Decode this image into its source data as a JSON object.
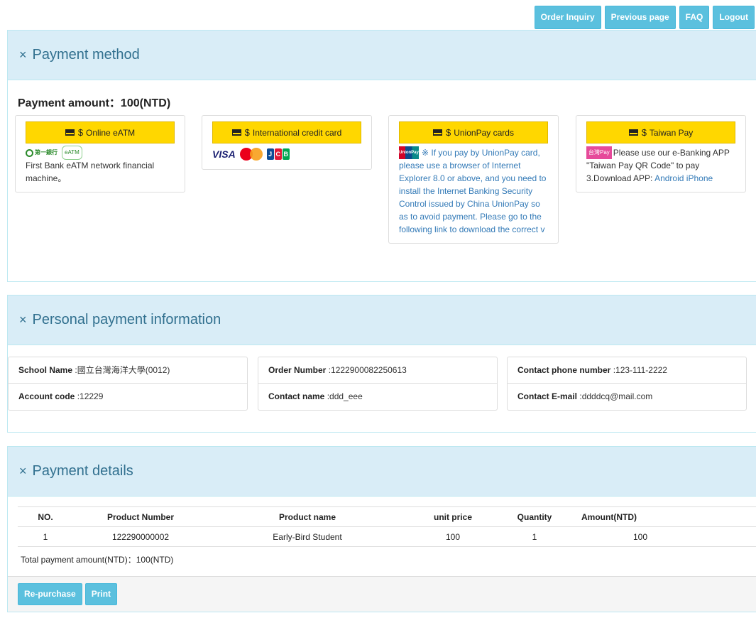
{
  "topnav": {
    "order_inquiry": "Order Inquiry",
    "previous_page": "Previous page",
    "faq": "FAQ",
    "logout": "Logout"
  },
  "payment_method": {
    "header": "Payment method",
    "close_glyph": "×",
    "amount_label": "Payment amount：",
    "amount_value": "100(NTD)",
    "options": [
      {
        "title": "Online eATM",
        "logo_1": "第一銀行",
        "logo_2": "eATM",
        "description": "First Bank eATM network financial machine。"
      },
      {
        "title": "International credit card",
        "logo_visa": "VISA",
        "logo_mc": "MasterCard",
        "logo_jcb": [
          "J",
          "C",
          "B"
        ]
      },
      {
        "title": "UnionPay cards",
        "logo": "UnionPay",
        "description": "※ If you pay by UnionPay card, please use a browser of Internet Explorer 8.0 or above, and you need to install the Internet Banking Security Control issued by China UnionPay so as to avoid payment. Please go to the following link to download the correct v"
      },
      {
        "title": "Taiwan Pay",
        "logo": "台灣Pay",
        "description": "Please use our e-Banking APP \"Taiwan Pay QR Code\" to pay 3.Download APP:",
        "link_android": "Android",
        "link_iphone": "iPhone"
      }
    ]
  },
  "personal": {
    "header": "Personal payment information",
    "fields": [
      {
        "label": "School Name",
        "value": ":國立台灣海洋大學(0012)"
      },
      {
        "label": "Account code",
        "value": ":12229"
      },
      {
        "label": "Order Number",
        "value": ":1222900082250613"
      },
      {
        "label": "Contact name",
        "value": ":ddd_eee"
      },
      {
        "label": "Contact phone number",
        "value": ":123-111-2222"
      },
      {
        "label": "Contact E-mail",
        "value": ":ddddcq@mail.com"
      }
    ]
  },
  "details": {
    "header": "Payment details",
    "columns": [
      "NO.",
      "Product Number",
      "Product name",
      "unit price",
      "Quantity",
      "Amount(NTD)"
    ],
    "rows": [
      [
        "1",
        "122290000002",
        "Early-Bird Student",
        "100",
        "1",
        "100"
      ]
    ],
    "total": "Total payment amount(NTD)：100(NTD)",
    "repurchase": "Re-purchase",
    "print": "Print"
  },
  "colors": {
    "accent": "#5bc0de",
    "panel_header": "#d9edf7",
    "panel_title": "#31708f",
    "pay_button": "#ffd700",
    "link": "#337ab7"
  }
}
